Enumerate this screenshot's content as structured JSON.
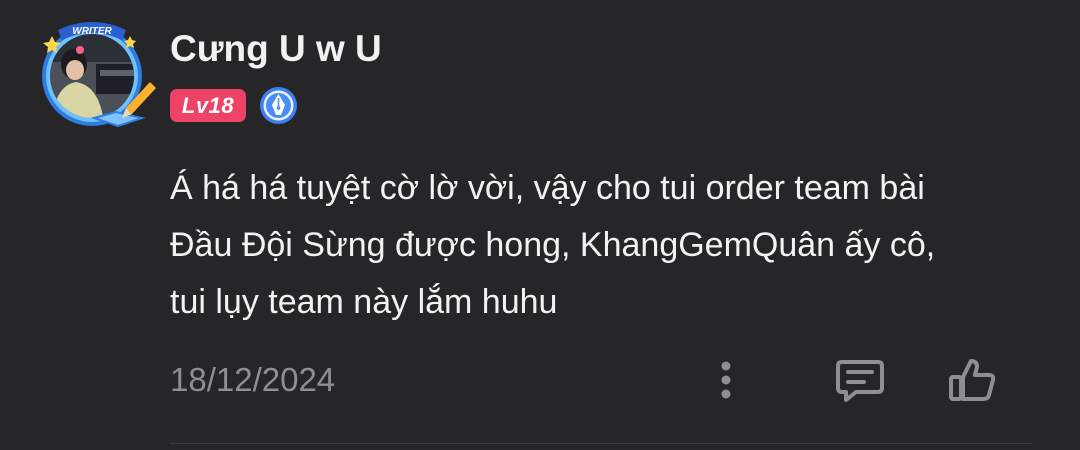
{
  "comment": {
    "author": {
      "name": "Cưng U w U",
      "avatar_frame_label": "WRITER",
      "level": "Lv18",
      "badge_icon": "pen-nib-icon"
    },
    "text_lines": [
      "Á há há tuyệt cờ lờ vời, vậy cho tui order team bài",
      "Đầu Đội Sừng được hong, KhangGemQuân ấy cô,",
      "tui lụy team này lắm huhu"
    ],
    "date": "18/12/2024",
    "actions": {
      "more_icon": "more-vertical-icon",
      "reply_icon": "comment-icon",
      "like_icon": "thumbs-up-icon"
    }
  },
  "colors": {
    "background": "#262628",
    "text": "#f2f2f2",
    "muted": "#8e8e93",
    "level_badge": "#ee4266",
    "writer_badge": "#3d7ff0"
  }
}
